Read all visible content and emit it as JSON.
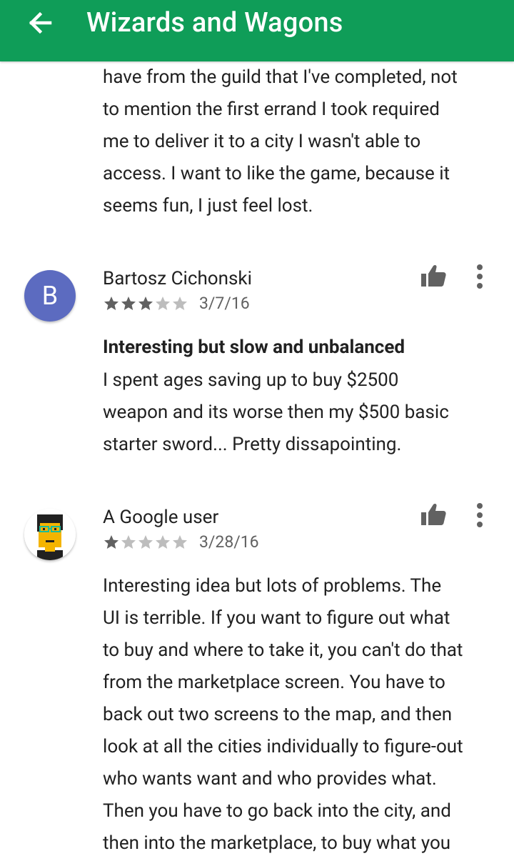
{
  "appbar": {
    "title": "Wizards and Wagons",
    "back_icon": "arrow-left-icon",
    "color": "#0f9d58"
  },
  "prev_review_tail": {
    "lines": [
      "have from the guild that I've completed, not",
      "to mention the first errand I took required",
      "me to deliver it to a city I wasn't able to",
      "access. I want to like the game, because it",
      "seems fun, I just feel lost."
    ]
  },
  "reviews": [
    {
      "avatar_letter": "B",
      "avatar_color": "#5c6bc0",
      "name": "Bartosz Cichonski",
      "rating": 3,
      "date": "3/7/16",
      "title": "Interesting but slow and unbalanced",
      "body_lines": [
        "I spent ages saving up to buy $2500",
        "weapon and its worse then my $500 basic",
        "starter sword... Pretty dissapointing."
      ]
    },
    {
      "avatar_letter": "",
      "name": "A Google user",
      "rating": 1,
      "date": "3/28/16",
      "title": "",
      "body_lines": [
        "Interesting idea but lots of problems. The",
        "UI is terrible. If you want to figure out what",
        "to buy and where to take it, you can't do that",
        "from the marketplace screen. You have to",
        "back out two screens to the map, and then",
        "look at all the cities individually to figure-out",
        "who wants want and who provides what.",
        "Then you have to go back into the city, and",
        "then into the marketplace, to buy what you"
      ]
    }
  ]
}
